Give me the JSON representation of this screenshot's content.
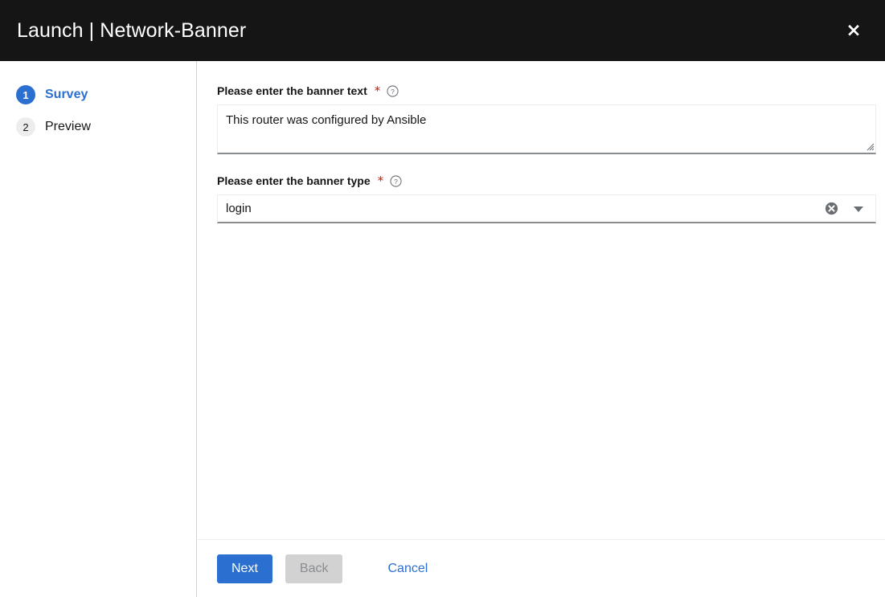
{
  "header": {
    "title": "Launch | Network-Banner",
    "close_label": "×",
    "close_icon": "close-icon"
  },
  "wizard": {
    "steps": [
      {
        "number": "1",
        "label": "Survey",
        "active": true
      },
      {
        "number": "2",
        "label": "Preview",
        "active": false
      }
    ]
  },
  "form": {
    "fields": [
      {
        "label": "Please enter the banner text",
        "required_mark": "*",
        "help_icon": "help-circle-icon",
        "type": "textarea",
        "value": "This router was configured by Ansible",
        "placeholder": ""
      },
      {
        "label": "Please enter the banner type",
        "required_mark": "*",
        "help_icon": "help-circle-icon",
        "type": "select",
        "value": "login",
        "placeholder": "",
        "clear_icon": "clear-circle-icon",
        "toggle_icon": "chevron-down-icon"
      }
    ]
  },
  "footer": {
    "next_label": "Next",
    "back_label": "Back",
    "cancel_label": "Cancel"
  },
  "colors": {
    "header_bg": "#151515",
    "accent_blue": "#2b6fd0",
    "required_red": "#c9190b",
    "disabled_bg": "#d2d2d2",
    "disabled_text": "#8a8d90",
    "border_light": "#ededed",
    "border_bottom": "#8a8d90"
  }
}
